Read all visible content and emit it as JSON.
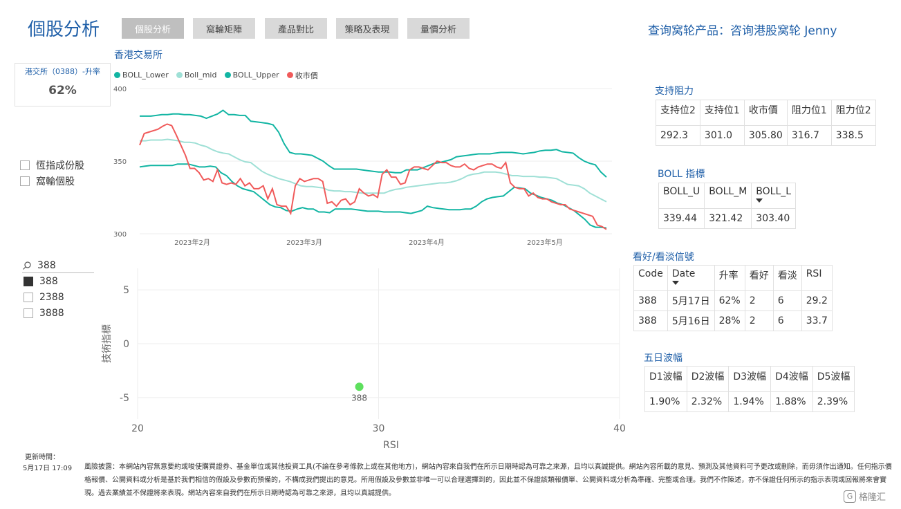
{
  "header": {
    "title": "個股分析",
    "tabs": [
      "個股分析",
      "窩輪矩陣",
      "產品對比",
      "策略及表現",
      "量價分析"
    ],
    "query_link": "查询窝轮产品：咨询港股窝轮 Jenny"
  },
  "stock_card": {
    "label": "港交所（0388）-升率",
    "value": "62%"
  },
  "filters": {
    "categories": [
      "恆指成份股",
      "窩輪個股"
    ],
    "search_value": "388",
    "codes": [
      "388",
      "2388",
      "3888"
    ],
    "selected_code": "388"
  },
  "boll_chart": {
    "title": "香港交易所",
    "colors": {
      "lower": "#12b5a3",
      "mid": "#9fe0d6",
      "upper": "#12b5a3",
      "close": "#f05a5a"
    }
  },
  "chart_data": [
    {
      "type": "line",
      "title": "香港交易所",
      "ylim": [
        300,
        400
      ],
      "yticks": [
        "400",
        "350",
        "300"
      ],
      "xticks": [
        "2023年2月",
        "2023年3月",
        "2023年4月",
        "2023年5月"
      ],
      "series": [
        {
          "name": "BOLL_Lower",
          "values": [
            346,
            346.5,
            347,
            347,
            347,
            347,
            347,
            348,
            348,
            348,
            347,
            346,
            346,
            346.5,
            346,
            342,
            340,
            336,
            333,
            331,
            330,
            329,
            326,
            323,
            320,
            318.5,
            318,
            316,
            315.5,
            317,
            318,
            317,
            317,
            315,
            315,
            314.5,
            317,
            317,
            317,
            317,
            316.5,
            316,
            315.5,
            315.5,
            315.5,
            315,
            315,
            315,
            315,
            314.5,
            314,
            315,
            316,
            319,
            318,
            317.5,
            317,
            316.5,
            316.5,
            316.5,
            317,
            317,
            319,
            322,
            324,
            325,
            325.5,
            326,
            329,
            332,
            331.5,
            331,
            328,
            326.5,
            325,
            324,
            323,
            321,
            320,
            318,
            316,
            313,
            310,
            306,
            304.5,
            304.5,
            304
          ]
        },
        {
          "name": "Boll_mid",
          "values": [
            364,
            364,
            364.5,
            364.5,
            364.5,
            365,
            364.5,
            364,
            363,
            363,
            362.5,
            361,
            360,
            358,
            356.5,
            355.5,
            355,
            353,
            351,
            349.5,
            349,
            346,
            343,
            341,
            339.5,
            338,
            337,
            336,
            334.5,
            333,
            332.5,
            332.5,
            332,
            331.5,
            330,
            329.5,
            329.5,
            329,
            329,
            328.5,
            328,
            328,
            328,
            328,
            328,
            329.5,
            330.5,
            331,
            332,
            332.5,
            333,
            333.5,
            334,
            334.5,
            335,
            335,
            335.5,
            336.5,
            338,
            340,
            341,
            341.5,
            342.5,
            342.5,
            342.5,
            342,
            341,
            340,
            340,
            339.5,
            339.5,
            339.5,
            339,
            339,
            338.5,
            338,
            336,
            334,
            333.5,
            333,
            331,
            328,
            326,
            324,
            322
          ]
        },
        {
          "name": "BOLL_Upper",
          "values": [
            381,
            381,
            381,
            381.5,
            382,
            382,
            382.5,
            382.5,
            382,
            382,
            381.5,
            381,
            379.5,
            381,
            382.5,
            385,
            382,
            382,
            381.5,
            381.5,
            377.5,
            377,
            376.5,
            376,
            375,
            370,
            362,
            356,
            355,
            355,
            354.5,
            354,
            352,
            350,
            347,
            344.5,
            344.5,
            344.5,
            344.5,
            344.5,
            344,
            343.5,
            343,
            342.5,
            342.5,
            342.5,
            342,
            342,
            344,
            344,
            344,
            345.5,
            347,
            348.5,
            349,
            350,
            351,
            353,
            353.5,
            354,
            354.5,
            355,
            355,
            355,
            355.5,
            356,
            356,
            356,
            355.5,
            355,
            355.5,
            356,
            357,
            357.5,
            357.5,
            358,
            356.5,
            356,
            355.5,
            352.5,
            350,
            348.5,
            347.5,
            342.5,
            339
          ]
        },
        {
          "name": "收市價",
          "values": [
            361,
            369,
            370,
            371,
            372,
            374,
            375.5,
            374.5,
            368,
            361,
            354,
            345,
            345,
            342,
            337,
            338,
            336,
            344,
            335,
            334,
            335,
            334,
            338,
            333,
            335,
            331,
            331,
            333,
            324,
            331,
            320,
            319,
            319,
            314,
            333,
            338,
            336,
            337,
            338,
            338,
            336,
            321,
            322,
            319,
            323,
            324,
            320,
            322,
            331,
            328,
            326,
            327,
            325,
            341,
            344,
            339,
            339,
            334,
            335,
            344,
            346,
            346,
            345,
            344,
            347,
            350,
            349,
            349,
            347,
            346,
            346,
            348,
            345,
            344,
            346,
            347,
            348,
            348,
            346,
            345,
            349,
            335,
            332,
            331,
            331,
            326,
            328,
            325,
            324,
            324,
            322,
            321,
            320,
            320,
            317,
            316,
            315,
            314,
            313,
            312,
            306,
            305,
            303
          ]
        }
      ]
    },
    {
      "type": "scatter",
      "xlabel": "RSI",
      "ylabel": "技術指標",
      "xlim": [
        20,
        40
      ],
      "ylim": [
        -7,
        7
      ],
      "xticks": [
        "20",
        "30",
        "40"
      ],
      "yticks": [
        "5",
        "0",
        "-5"
      ],
      "points": [
        {
          "x": 29.2,
          "y": -4,
          "label": "388"
        }
      ]
    }
  ],
  "support_resistance": {
    "title": "支持阻力",
    "headers": [
      "支持位2",
      "支持位1",
      "收市價",
      "阻力位1",
      "阻力位2"
    ],
    "values": [
      "292.3",
      "301.0",
      "305.80",
      "316.7",
      "338.5"
    ]
  },
  "boll_indicator": {
    "title": "BOLL 指標",
    "headers": [
      "BOLL_U",
      "BOLL_M",
      "BOLL_L"
    ],
    "values": [
      "339.44",
      "321.42",
      "303.40"
    ]
  },
  "signals": {
    "title": "看好/看淡信號",
    "headers": [
      "Code",
      "Date",
      "升率",
      "看好",
      "看淡",
      "RSI"
    ],
    "rows": [
      [
        "388",
        "5月17日",
        "62%",
        "2",
        "6",
        "29.2"
      ],
      [
        "388",
        "5月16日",
        "28%",
        "2",
        "6",
        "33.7"
      ]
    ]
  },
  "volatility": {
    "title": "五日波幅",
    "headers": [
      "D1波幅",
      "D2波幅",
      "D3波幅",
      "D4波幅",
      "D5波幅"
    ],
    "values": [
      "1.90%",
      "2.32%",
      "1.94%",
      "1.88%",
      "2.39%"
    ]
  },
  "footer": {
    "update_label": "更新時間：",
    "update_time": "5月17日 17:09",
    "disclaimer": "風險披露：本網站內容無意要約或唆使購買證券、基金單位或其他投資工具(不論在參考條款上或在其他地方)，網站內容來自我們在所示日期時認為可靠之來源，且均以真誠提供。網站內容所載的意見、預測及其他資料可予更改或刪除，而毋須作出通知。任何指示價格報價、公開資料或分析是基於我們相信的假設及參數而預備的，不構成我們提出的意見。所用假設及參數並非唯一可以合理選擇到的，因此並不保證該類報價單、公開資料或分析為準確、完整或合理。我們不作陳述，亦不保證任何所示的指示表現或回報將來會實現。過去業績並不保證將來表現。網站內容來自我們在所示日期時認為可靠之來源，且均以真誠提供。",
    "watermark": "格隆汇"
  }
}
